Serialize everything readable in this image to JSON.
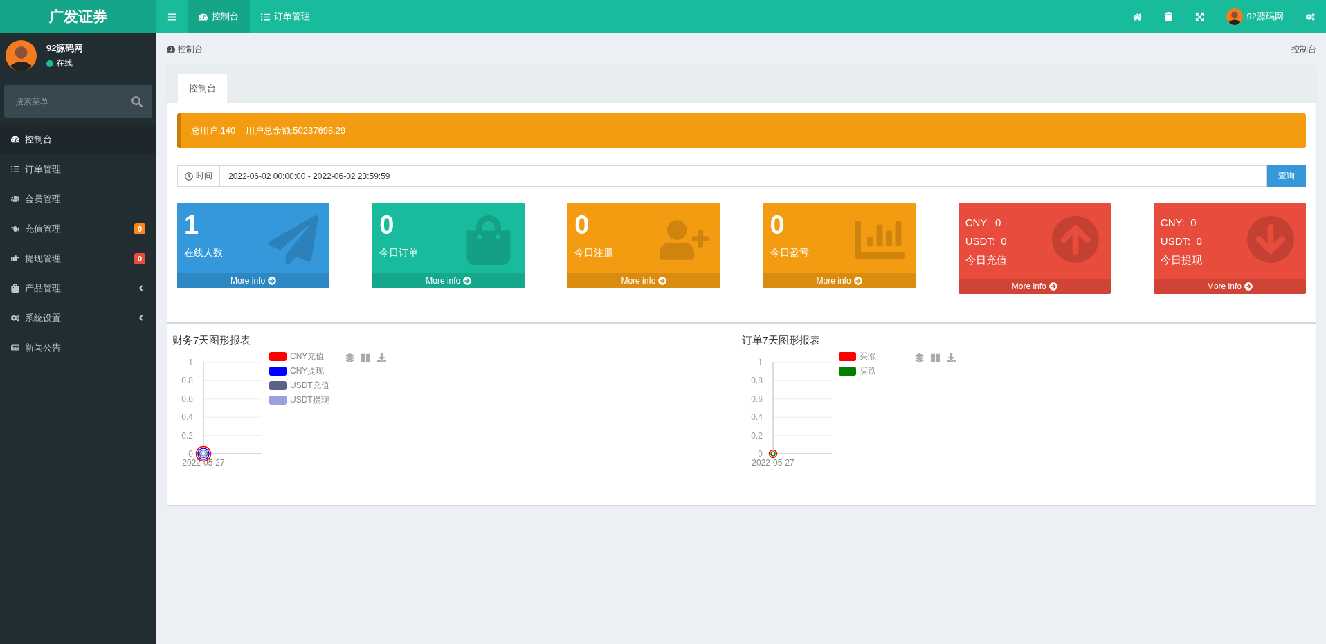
{
  "brand": "广发证券",
  "user": {
    "name": "92源码网",
    "status": "在线"
  },
  "search": {
    "placeholder": "搜索菜单"
  },
  "sidebar": {
    "items": [
      {
        "label": "控制台",
        "selected": true
      },
      {
        "label": "订单管理",
        "selected": false
      },
      {
        "label": "会员管理",
        "selected": false
      },
      {
        "label": "充值管理",
        "selected": false,
        "badge": {
          "text": "0",
          "color": "#ff851b"
        }
      },
      {
        "label": "提现管理",
        "selected": false,
        "badge": {
          "text": "0",
          "color": "#e74c3c"
        }
      },
      {
        "label": "产品管理",
        "selected": false,
        "expanded": false
      },
      {
        "label": "系统设置",
        "selected": false,
        "expanded": false
      },
      {
        "label": "新闻公告",
        "selected": false
      }
    ]
  },
  "topbar": {
    "tabs": [
      {
        "label": "控制台",
        "selected": true
      },
      {
        "label": "订单管理",
        "selected": false
      }
    ],
    "user": "92源码网"
  },
  "breadcrumb": {
    "left": "控制台",
    "right": "控制台"
  },
  "panel_tabs": [
    {
      "label": "控制台",
      "selected": true
    }
  ],
  "alert": {
    "text": "总用户:140    用户总余额:50237698.29"
  },
  "filter": {
    "label": "时间",
    "value": "2022-06-02 00:00:00 - 2022-06-02 23:59:59",
    "button": "查询"
  },
  "cards": [
    {
      "kind": "stat",
      "color": "#3498db",
      "number": "1",
      "label": "在线人数",
      "more": "More info"
    },
    {
      "kind": "stat",
      "color": "#18bc9c",
      "number": "0",
      "label": "今日订单",
      "more": "More info"
    },
    {
      "kind": "stat",
      "color": "#f39c12",
      "number": "0",
      "label": "今日注册",
      "more": "More info"
    },
    {
      "kind": "stat",
      "color": "#f39c12",
      "number": "0",
      "label": "今日盈亏",
      "more": "More info"
    },
    {
      "kind": "money",
      "color": "#e74c3c",
      "lines": [
        "CNY:  0",
        "USDT:  0"
      ],
      "label": "今日充值",
      "more": "More info"
    },
    {
      "kind": "money",
      "color": "#e74c3c",
      "lines": [
        "CNY:  0",
        "USDT:  0"
      ],
      "label": "今日提现",
      "more": "More info"
    }
  ],
  "charts": [
    {
      "chart_data": {
        "type": "line",
        "title": "财务7天图形报表",
        "grid": true,
        "categories": [
          "2022-05-27"
        ],
        "ylim": [
          0,
          1
        ],
        "yticks": [
          0,
          0.2,
          0.4,
          0.6,
          0.8,
          1
        ],
        "series": [
          {
            "name": "CNY充值",
            "color": "#ff0000",
            "marker": "circle",
            "values": [
              0
            ]
          },
          {
            "name": "CNY提现",
            "color": "#0000ff",
            "marker": "circle",
            "values": [
              0
            ]
          },
          {
            "name": "USDT充值",
            "color": "#5b6385",
            "marker": "circle",
            "values": [
              0
            ]
          },
          {
            "name": "USDT提现",
            "color": "#9aa0e0",
            "marker": "circle",
            "values": [
              0
            ]
          }
        ]
      }
    },
    {
      "chart_data": {
        "type": "line",
        "title": "订单7天图形报表",
        "grid": true,
        "categories": [
          "2022-05-27"
        ],
        "ylim": [
          0,
          1
        ],
        "yticks": [
          0,
          0.2,
          0.4,
          0.6,
          0.8,
          1
        ],
        "series": [
          {
            "name": "买涨",
            "color": "#ff0000",
            "marker": "circle",
            "values": [
              0
            ]
          },
          {
            "name": "买跌",
            "color": "#008000",
            "marker": "circle",
            "values": [
              0
            ]
          }
        ]
      }
    }
  ]
}
